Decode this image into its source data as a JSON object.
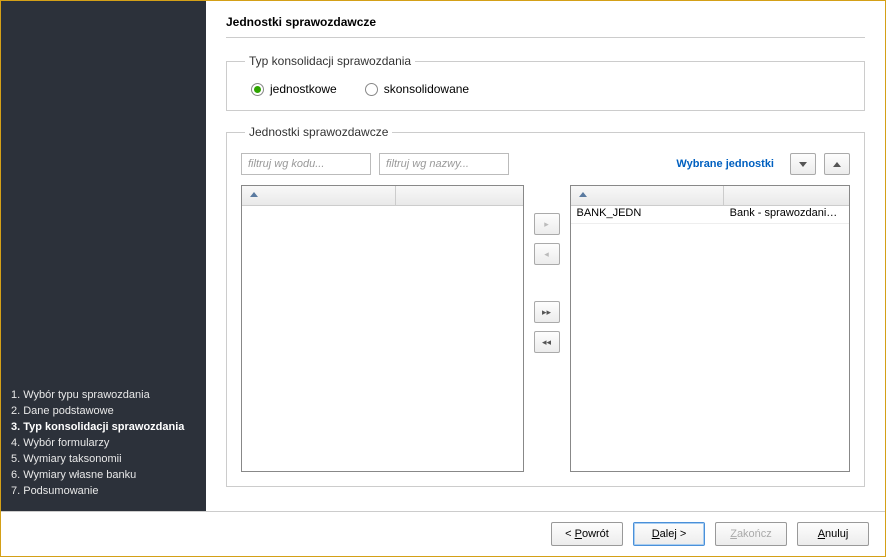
{
  "sidebar": {
    "steps": [
      {
        "label": "1. Wybór typu sprawozdania",
        "active": false
      },
      {
        "label": "2. Dane podstawowe",
        "active": false
      },
      {
        "label": "3. Typ konsolidacji sprawozdania",
        "active": true
      },
      {
        "label": "4. Wybór formularzy",
        "active": false
      },
      {
        "label": "5. Wymiary taksonomii",
        "active": false
      },
      {
        "label": "6. Wymiary własne banku",
        "active": false
      },
      {
        "label": "7. Podsumowanie",
        "active": false
      }
    ]
  },
  "page_title": "Jednostki sprawozdawcze",
  "group_consolidation": {
    "legend": "Typ konsolidacji sprawozdania",
    "options": [
      {
        "label": "jednostkowe",
        "checked": true
      },
      {
        "label": "skonsolidowane",
        "checked": false
      }
    ]
  },
  "group_units": {
    "legend": "Jednostki sprawozdawcze",
    "filter_code_placeholder": "filtruj wg kodu...",
    "filter_name_placeholder": "filtruj wg nazwy...",
    "selected_label": "Wybrane jednostki",
    "available_rows": [],
    "selected_rows": [
      {
        "code": "BANK_JEDN",
        "name": "Bank - sprawozdania je..."
      }
    ]
  },
  "footer": {
    "back": "Powrót",
    "next": "Dalej >",
    "finish": "Zakończ",
    "cancel": "Anuluj"
  }
}
